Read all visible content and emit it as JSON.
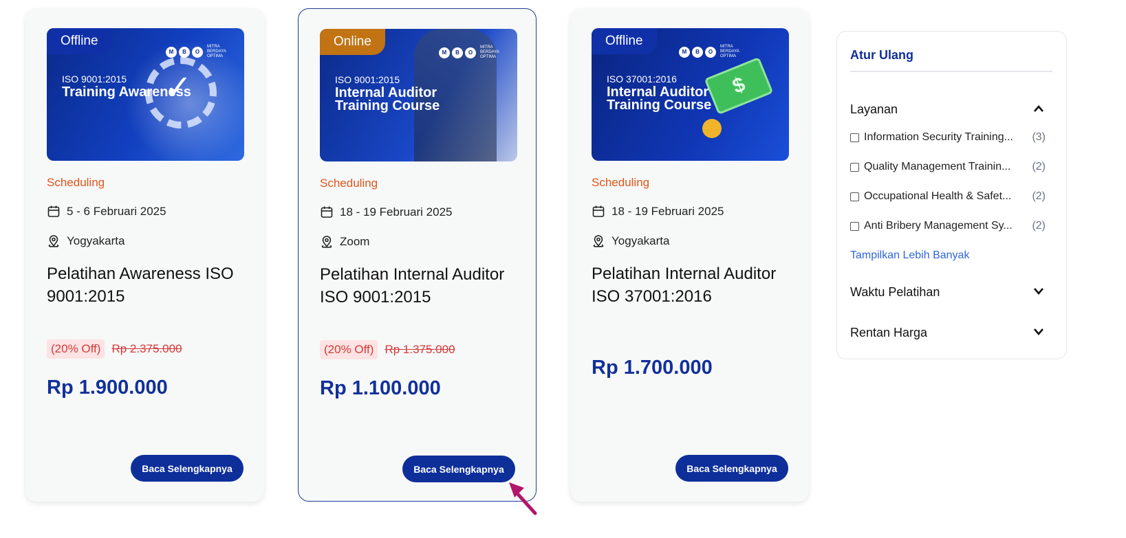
{
  "cards": [
    {
      "mode": "Offline",
      "image_subtitle": "ISO 9001:2015",
      "image_title": "Training Awareness",
      "status": "Scheduling",
      "date": "5 - 6 Februari 2025",
      "location": "Yogyakarta",
      "title": "Pelatihan Awareness ISO 9001:2015",
      "discount": "(20% Off)",
      "old_price": "Rp 2.375.000",
      "price": "Rp 1.900.000",
      "button": "Baca Selengkapnya"
    },
    {
      "mode": "Online",
      "image_subtitle": "ISO 9001:2015",
      "image_title": "Internal Auditor Training Course",
      "status": "Scheduling",
      "date": "18 - 19 Februari 2025",
      "location": "Zoom",
      "title": "Pelatihan Internal Auditor ISO 9001:2015",
      "discount": "(20% Off)",
      "old_price": "Rp 1.375.000",
      "price": "Rp 1.100.000",
      "button": "Baca Selengkapnya"
    },
    {
      "mode": "Offline",
      "image_subtitle": "ISO 37001:2016",
      "image_title": "Internal Auditor Training Course",
      "status": "Scheduling",
      "date": "18 - 19 Februari 2025",
      "location": "Yogyakarta",
      "title": "Pelatihan Internal Auditor ISO 37001:2016",
      "price": "Rp 1.700.000",
      "button": "Baca Selengkapnya"
    }
  ],
  "logo": {
    "letters": [
      "M",
      "B",
      "O"
    ],
    "text": "MITRA BERDAYA OPTIMA"
  },
  "sidebar": {
    "reset": "Atur Ulang",
    "layanan": {
      "title": "Layanan",
      "options": [
        {
          "label": "Information Security Training...",
          "count": "(3)"
        },
        {
          "label": "Quality Management Trainin...",
          "count": "(2)"
        },
        {
          "label": "Occupational Health & Safet...",
          "count": "(2)"
        },
        {
          "label": "Anti Bribery Management Sy...",
          "count": "(2)"
        }
      ],
      "more": "Tampilkan Lebih Banyak"
    },
    "waktu": "Waktu Pelatihan",
    "harga": "Rentan Harga"
  },
  "colors": {
    "primary": "#0e2f9a",
    "accent": "#e0551a",
    "discount": "#d43a3a",
    "online_tag": "#c27313"
  },
  "cursor_color": "#b1166a"
}
